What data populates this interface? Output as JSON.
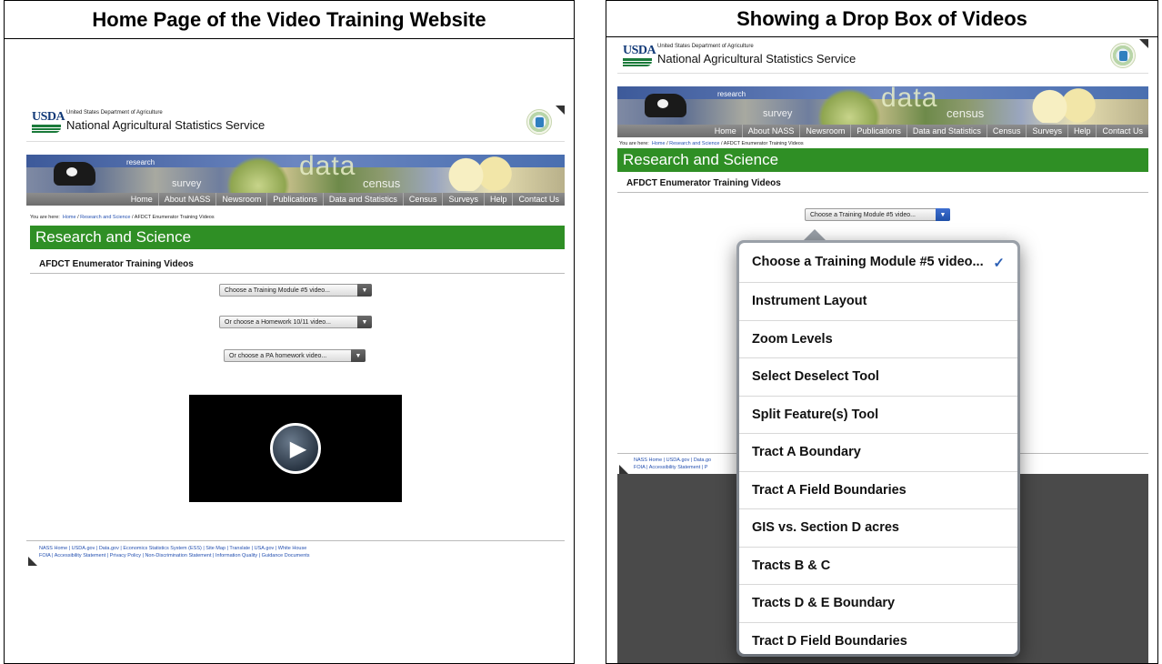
{
  "left_panel": {
    "title": "Home Page of the Video Training  Website",
    "site": {
      "usda_word": "USDA",
      "department": "United States Department of Agriculture",
      "agency": "National Agricultural Statistics Service",
      "banner_words": {
        "research": "research",
        "survey": "survey",
        "data": "data",
        "census": "census"
      },
      "nav": [
        "Home",
        "About NASS",
        "Newsroom",
        "Publications",
        "Data and Statistics",
        "Census",
        "Surveys",
        "Help",
        "Contact Us"
      ],
      "breadcrumb": {
        "prefix": "You are here:",
        "links": [
          "Home",
          "Research and Science"
        ],
        "current": "AFDCT Enumerator Training Videos"
      },
      "section_bar": "Research and Science",
      "section_title": "AFDCT Enumerator Training Videos",
      "dropdowns": [
        "Choose a Training Module #5 video...",
        "Or choose a Homework 10/11 video...",
        "Or choose a PA homework video..."
      ],
      "footer_line1": "NASS Home | USDA.gov | Data.gov | Economics Statistics System (ESS) | Site Map | Translate | USA.gov | White House",
      "footer_line2": "FOIA | Accessibility Statement | Privacy Policy | Non-Discrimination Statement | Information Quality | Guidance Documents"
    }
  },
  "right_panel": {
    "title": "Showing a Drop Box of Videos",
    "site": {
      "usda_word": "USDA",
      "department": "United States Department of Agriculture",
      "agency": "National Agricultural Statistics Service",
      "banner_words": {
        "research": "research",
        "survey": "survey",
        "data": "data",
        "census": "census"
      },
      "nav": [
        "Home",
        "About NASS",
        "Newsroom",
        "Publications",
        "Data and Statistics",
        "Census",
        "Surveys",
        "Help",
        "Contact Us"
      ],
      "breadcrumb": {
        "prefix": "You are here:",
        "links": [
          "Home",
          "Research and Science"
        ],
        "current": "AFDCT Enumerator Training Videos"
      },
      "section_bar": "Research and Science",
      "section_title": "AFDCT Enumerator Training Videos",
      "dropdown": "Choose a Training Module #5 video...",
      "footer_line1": "NASS Home | USDA.gov | Data.go",
      "footer_line2": "FOIA | Accessibility Statement | P"
    },
    "popup": {
      "selected_check": "✓",
      "options": [
        "Choose a Training Module #5 video...",
        "Instrument Layout",
        "Zoom Levels",
        "Select Deselect Tool",
        "Split Feature(s) Tool",
        "Tract A Boundary",
        "Tract A Field Boundaries",
        "GIS vs. Section D acres",
        "Tracts B & C",
        "Tracts D & E Boundary",
        "Tract D Field Boundaries"
      ]
    }
  },
  "colors": {
    "green_bar": "#2f8f25",
    "nav_gray": "#7a7a7a",
    "link_blue": "#2450b0",
    "check_blue": "#2b5fb4"
  },
  "icons": {
    "play": "play-icon",
    "dropdown_arrow": "chevron-down-icon",
    "check": "check-icon"
  }
}
